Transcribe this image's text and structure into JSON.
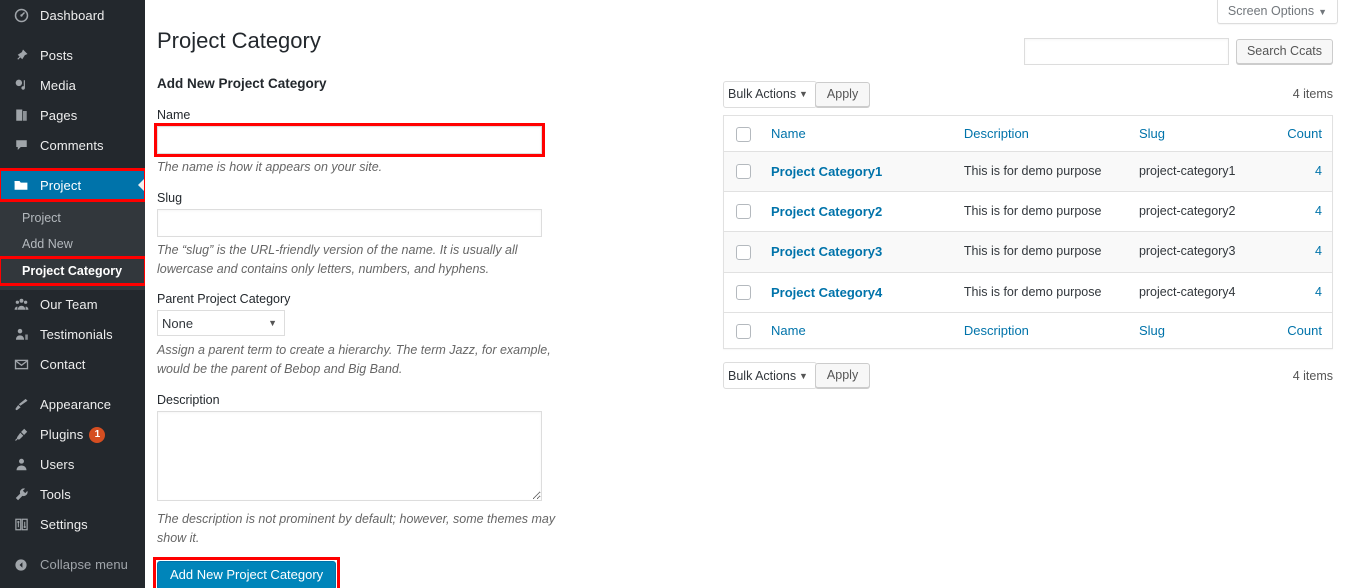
{
  "sidebar": {
    "items": [
      {
        "label": "Dashboard",
        "icon": "dashboard-icon",
        "glyph": "◔",
        "name": "dashboard"
      },
      {
        "label": "Posts",
        "icon": "pin-icon",
        "glyph": "📌",
        "name": "posts"
      },
      {
        "label": "Media",
        "icon": "media-icon",
        "glyph": "🖼",
        "name": "media"
      },
      {
        "label": "Pages",
        "icon": "pages-icon",
        "glyph": "📄",
        "name": "pages"
      },
      {
        "label": "Comments",
        "icon": "comment-icon",
        "glyph": "💬",
        "name": "comments"
      },
      {
        "label": "Project",
        "icon": "folder-icon",
        "glyph": "📁",
        "name": "project",
        "current": true
      },
      {
        "label": "Our Team",
        "icon": "group-icon",
        "glyph": "👥",
        "name": "our-team"
      },
      {
        "label": "Testimonials",
        "icon": "testimonial-icon",
        "glyph": "👤",
        "name": "testimonials"
      },
      {
        "label": "Contact",
        "icon": "envelope-icon",
        "glyph": "✉",
        "name": "contact"
      },
      {
        "label": "Appearance",
        "icon": "brush-icon",
        "glyph": "🖌",
        "name": "appearance"
      },
      {
        "label": "Plugins",
        "icon": "plug-icon",
        "glyph": "🔌",
        "name": "plugins",
        "badge": "1"
      },
      {
        "label": "Users",
        "icon": "user-icon",
        "glyph": "👤",
        "name": "users"
      },
      {
        "label": "Tools",
        "icon": "wrench-icon",
        "glyph": "🔧",
        "name": "tools"
      },
      {
        "label": "Settings",
        "icon": "sliders-icon",
        "glyph": "⚙",
        "name": "settings"
      },
      {
        "label": "Collapse menu",
        "icon": "collapse-icon",
        "glyph": "◀",
        "name": "collapse-menu"
      }
    ],
    "submenu": [
      {
        "label": "Project",
        "name": "project"
      },
      {
        "label": "Add New",
        "name": "add-new"
      },
      {
        "label": "Project Category",
        "name": "project-category",
        "current": true
      }
    ],
    "colors": {
      "background": "#23282d",
      "submenu_background": "#32373c",
      "current_highlight": "#0073aa",
      "badge": "#d54e21"
    }
  },
  "header": {
    "screen_options_label": "Screen Options",
    "screen_options_caret": "▼",
    "page_title": "Project Category"
  },
  "form": {
    "heading": "Add New Project Category",
    "name_label": "Name",
    "name_value": "",
    "name_help": "The name is how it appears on your site.",
    "slug_label": "Slug",
    "slug_value": "",
    "slug_help": "The “slug” is the URL-friendly version of the name. It is usually all lowercase and contains only letters, numbers, and hyphens.",
    "parent_label": "Parent Project Category",
    "parent_selected": "None",
    "parent_options": [
      "None"
    ],
    "parent_caret": "▼",
    "parent_help": "Assign a parent term to create a hierarchy. The term Jazz, for example, would be the parent of Bebop and Big Band.",
    "description_label": "Description",
    "description_value": "",
    "description_help": "The description is not prominent by default; however, some themes may show it.",
    "submit_label": "Add New Project Category",
    "submit_color": "#0085ba",
    "annotation_color": "#ff0000"
  },
  "search": {
    "value": "",
    "button_label": "Search Ccats"
  },
  "tablenav_top": {
    "bulk_selected": "Bulk Actions",
    "bulk_options": [
      "Bulk Actions"
    ],
    "bulk_caret": "▼",
    "apply_label": "Apply",
    "items_count": "4 items"
  },
  "tablenav_bottom": {
    "bulk_selected": "Bulk Actions",
    "bulk_options": [
      "Bulk Actions"
    ],
    "bulk_caret": "▼",
    "apply_label": "Apply",
    "items_count": "4 items"
  },
  "table": {
    "columns": [
      "Name",
      "Description",
      "Slug",
      "Count"
    ],
    "rows": [
      {
        "name": "Project Category1",
        "description": "This is for demo purpose",
        "slug": "project-category1",
        "count": "4"
      },
      {
        "name": "Project Category2",
        "description": "This is for demo purpose",
        "slug": "project-category2",
        "count": "4"
      },
      {
        "name": "Project Category3",
        "description": "This is for demo purpose",
        "slug": "project-category3",
        "count": "4"
      },
      {
        "name": "Project Category4",
        "description": "This is for demo purpose",
        "slug": "project-category4",
        "count": "4"
      }
    ],
    "link_color": "#0073aa"
  }
}
